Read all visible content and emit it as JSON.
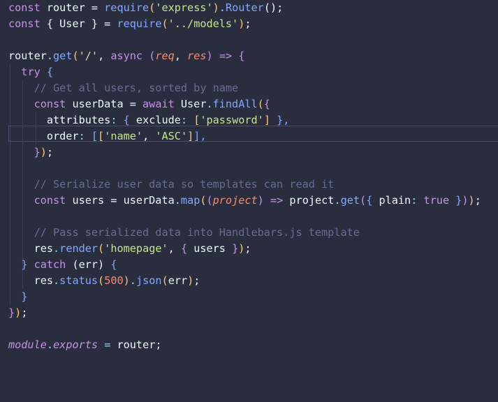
{
  "editor": {
    "language": "javascript",
    "theme": "Palenight",
    "lines": [
      [
        [
          "const",
          "kw"
        ],
        [
          " router = ",
          "tx"
        ],
        [
          "require",
          "fn"
        ],
        [
          "(",
          "br1"
        ],
        [
          "'express'",
          "str"
        ],
        [
          ")",
          "br1"
        ],
        [
          ".",
          "pn"
        ],
        [
          "Router",
          "fn"
        ],
        [
          "();",
          "tx"
        ]
      ],
      [
        [
          "const",
          "kw"
        ],
        [
          " { ",
          "tx"
        ],
        [
          "User",
          "tx"
        ],
        [
          " } = ",
          "tx"
        ],
        [
          "require",
          "fn"
        ],
        [
          "(",
          "br1"
        ],
        [
          "'../models'",
          "str"
        ],
        [
          ")",
          "br1"
        ],
        [
          ";",
          "tx"
        ]
      ],
      [],
      [
        [
          "router",
          "tx"
        ],
        [
          ".",
          "pn"
        ],
        [
          "get",
          "fn"
        ],
        [
          "(",
          "br1"
        ],
        [
          "'/'",
          "str"
        ],
        [
          ", ",
          "tx"
        ],
        [
          "async",
          "kw"
        ],
        [
          " (",
          "br2"
        ],
        [
          "req",
          "pr"
        ],
        [
          ", ",
          "tx"
        ],
        [
          "res",
          "pr"
        ],
        [
          ") ",
          "br2"
        ],
        [
          "=>",
          "kw"
        ],
        [
          " {",
          "br2"
        ]
      ],
      [
        [
          "  ",
          "tx"
        ],
        [
          "try",
          "kw"
        ],
        [
          " {",
          "br3"
        ]
      ],
      [
        [
          "    ",
          "tx"
        ],
        [
          "// Get all users, sorted by name",
          "cm"
        ]
      ],
      [
        [
          "    ",
          "tx"
        ],
        [
          "const",
          "kw"
        ],
        [
          " userData = ",
          "tx"
        ],
        [
          "await",
          "kw"
        ],
        [
          " User",
          "tx"
        ],
        [
          ".",
          "pn"
        ],
        [
          "findAll",
          "fn"
        ],
        [
          "(",
          "br1"
        ],
        [
          "{",
          "br2"
        ]
      ],
      [
        [
          "      attributes",
          "tx"
        ],
        [
          ":",
          "pn"
        ],
        [
          " { ",
          "br3"
        ],
        [
          "exclude",
          "tx"
        ],
        [
          ":",
          "pn"
        ],
        [
          " [",
          "br1"
        ],
        [
          "'password'",
          "str"
        ],
        [
          "]",
          "br1"
        ],
        [
          " },",
          "br3"
        ]
      ],
      [
        [
          "      order",
          "tx"
        ],
        [
          ":",
          "pn"
        ],
        [
          " [",
          "br3"
        ],
        [
          "[",
          "br1"
        ],
        [
          "'name'",
          "str"
        ],
        [
          ", ",
          "tx"
        ],
        [
          "'ASC'",
          "str"
        ],
        [
          "]",
          "br1"
        ],
        [
          "],",
          "br3"
        ]
      ],
      [
        [
          "    ",
          "tx"
        ],
        [
          "}",
          "br2"
        ],
        [
          ")",
          "br1"
        ],
        [
          ";",
          "tx"
        ]
      ],
      [],
      [
        [
          "    ",
          "tx"
        ],
        [
          "// Serialize user data so templates can read it",
          "cm"
        ]
      ],
      [
        [
          "    ",
          "tx"
        ],
        [
          "const",
          "kw"
        ],
        [
          " users = userData",
          "tx"
        ],
        [
          ".",
          "pn"
        ],
        [
          "map",
          "fn"
        ],
        [
          "(",
          "br1"
        ],
        [
          "(",
          "br2"
        ],
        [
          "project",
          "pr"
        ],
        [
          ")",
          "br2"
        ],
        [
          " ",
          "tx"
        ],
        [
          "=>",
          "kw"
        ],
        [
          " project",
          "tx"
        ],
        [
          ".",
          "pn"
        ],
        [
          "get",
          "fn"
        ],
        [
          "(",
          "br2"
        ],
        [
          "{ ",
          "br3"
        ],
        [
          "plain",
          "tx"
        ],
        [
          ":",
          "pn"
        ],
        [
          " ",
          "tx"
        ],
        [
          "true",
          "kw"
        ],
        [
          " }",
          "br3"
        ],
        [
          ")",
          "br2"
        ],
        [
          ")",
          "br1"
        ],
        [
          ";",
          "tx"
        ]
      ],
      [],
      [
        [
          "    ",
          "tx"
        ],
        [
          "// Pass serialized data into Handlebars.js template",
          "cm"
        ]
      ],
      [
        [
          "    res",
          "tx"
        ],
        [
          ".",
          "pn"
        ],
        [
          "render",
          "fn"
        ],
        [
          "(",
          "br1"
        ],
        [
          "'homepage'",
          "str"
        ],
        [
          ", ",
          "tx"
        ],
        [
          "{",
          "br2"
        ],
        [
          " users ",
          "tx"
        ],
        [
          "}",
          "br2"
        ],
        [
          ")",
          "br1"
        ],
        [
          ";",
          "tx"
        ]
      ],
      [
        [
          "  ",
          "tx"
        ],
        [
          "}",
          "br3"
        ],
        [
          " ",
          "tx"
        ],
        [
          "catch",
          "kw"
        ],
        [
          " (err) ",
          "tx"
        ],
        [
          "{",
          "br3"
        ]
      ],
      [
        [
          "    res",
          "tx"
        ],
        [
          ".",
          "pn"
        ],
        [
          "status",
          "fn"
        ],
        [
          "(",
          "br1"
        ],
        [
          "500",
          "num"
        ],
        [
          ")",
          "br1"
        ],
        [
          ".",
          "pn"
        ],
        [
          "json",
          "fn"
        ],
        [
          "(",
          "br1"
        ],
        [
          "err",
          "tx"
        ],
        [
          ")",
          "br1"
        ],
        [
          ";",
          "tx"
        ]
      ],
      [
        [
          "  ",
          "tx"
        ],
        [
          "}",
          "br3"
        ]
      ],
      [
        [
          "}",
          "br2"
        ],
        [
          ")",
          "br1"
        ],
        [
          ";",
          "tx"
        ]
      ],
      [],
      [
        [
          "module",
          "it"
        ],
        [
          ".",
          "pn"
        ],
        [
          "exports",
          "it"
        ],
        [
          " ",
          "tx"
        ],
        [
          "=",
          "pn"
        ],
        [
          " router;",
          "tx"
        ]
      ]
    ]
  }
}
